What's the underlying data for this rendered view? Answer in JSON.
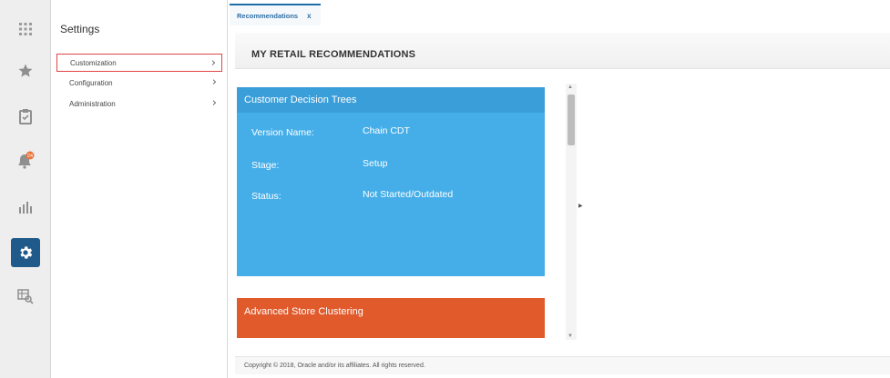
{
  "rail": {
    "items": [
      {
        "icon": "app-grid-icon"
      },
      {
        "icon": "favorites-star-icon"
      },
      {
        "icon": "tasks-clipboard-icon"
      },
      {
        "icon": "notifications-bell-icon",
        "badge": "24"
      },
      {
        "icon": "reports-bar-chart-icon"
      },
      {
        "icon": "settings-gear-icon",
        "active": true
      },
      {
        "icon": "data-viewer-icon"
      }
    ],
    "active_color": "#1f5a8a"
  },
  "settings": {
    "title": "Settings",
    "items": [
      {
        "label": "Customization",
        "selected": true
      },
      {
        "label": "Configuration"
      },
      {
        "label": "Administration"
      }
    ]
  },
  "tabs": [
    {
      "label": "Recommendations",
      "close": "x"
    }
  ],
  "main": {
    "title": "MY RETAIL RECOMMENDATIONS",
    "cards": [
      {
        "title": "Customer Decision Trees",
        "color": "#45aee8",
        "fields": [
          {
            "label": "Version Name:",
            "value": "Chain CDT"
          },
          {
            "label": "Stage:",
            "value": "Setup"
          },
          {
            "label": "Status:",
            "value": "Not Started/Outdated"
          }
        ]
      },
      {
        "title": "Advanced Store Clustering",
        "color": "#e05a2c"
      }
    ]
  },
  "footer": {
    "copyright": "Copyright © 2018, Oracle and/or its affiliates. All rights reserved."
  }
}
